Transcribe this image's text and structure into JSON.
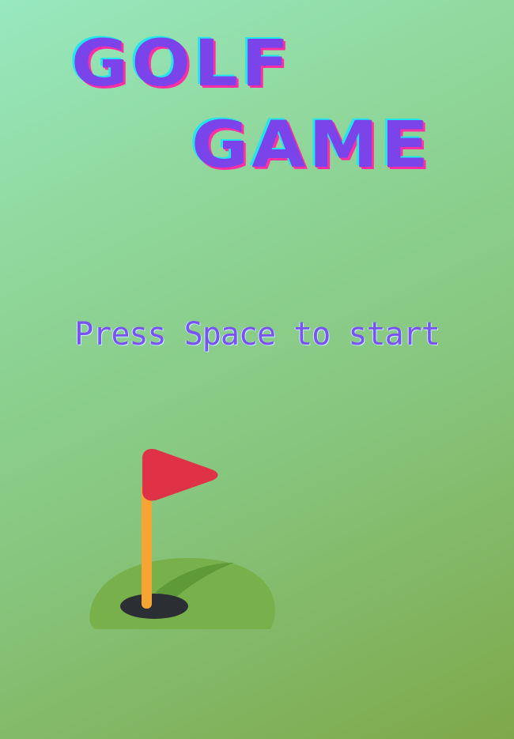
{
  "title": {
    "line1": "GOLF",
    "line2": "GAME"
  },
  "prompt": "Press Space to start",
  "icon": "golf-flag-hole-icon",
  "colors": {
    "title_fill": "#7a44ea",
    "title_cyan_shadow": "#22e6ee",
    "title_pink_shadow": "#ff2fa3",
    "prompt": "#7a52f0",
    "flag": "#e03246",
    "pole": "#f7a433",
    "green": "#78b04c",
    "hole": "#2b2e33"
  }
}
